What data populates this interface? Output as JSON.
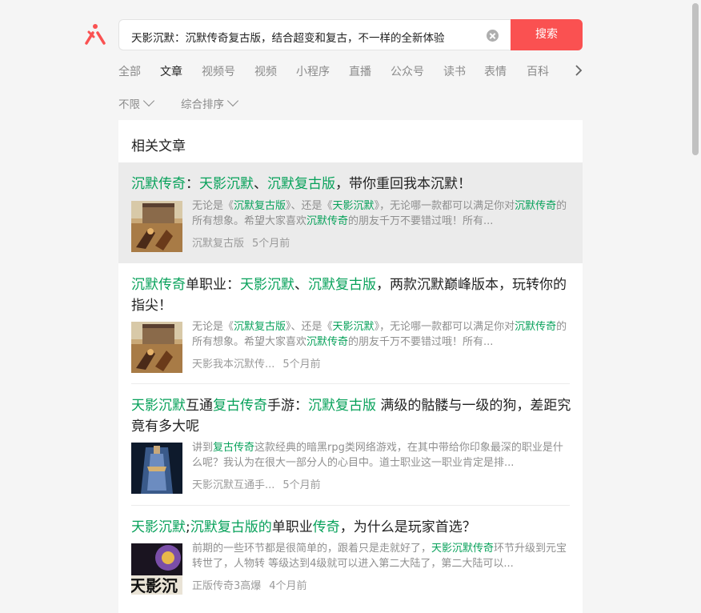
{
  "search": {
    "query": "天影沉默：沉默传奇复古版，结合超变和复古，不一样的全新体验",
    "button": "搜索"
  },
  "tabs": [
    "全部",
    "文章",
    "视频号",
    "视频",
    "小程序",
    "直播",
    "公众号",
    "读书",
    "表情",
    "百科"
  ],
  "filters": [
    "不限",
    "综合排序"
  ],
  "section_title": "相关文章",
  "articles": [
    {
      "title": [
        [
          "g",
          "沉默传奇"
        ],
        [
          "n",
          "："
        ],
        [
          "g",
          "天影沉默"
        ],
        [
          "n",
          "、"
        ],
        [
          "g",
          "沉默复古版"
        ],
        [
          "n",
          "，带你重回我本沉默！"
        ]
      ],
      "desc": [
        [
          "n",
          "无论是《"
        ],
        [
          "g",
          "沉默复古版"
        ],
        [
          "n",
          "》、还是《"
        ],
        [
          "g",
          "天影沉默"
        ],
        [
          "n",
          "》，无论哪一款都可以满足你对"
        ],
        [
          "g",
          "沉默传奇"
        ],
        [
          "n",
          "的所有想象。希望大家喜欢"
        ],
        [
          "g",
          "沉默传奇"
        ],
        [
          "n",
          "的朋友千万不要错过哦！所有..."
        ]
      ],
      "source": "沉默复古版",
      "time": "5个月前"
    },
    {
      "title": [
        [
          "g",
          "沉默传奇"
        ],
        [
          "n",
          "单职业："
        ],
        [
          "g",
          "天影沉默"
        ],
        [
          "n",
          "、"
        ],
        [
          "g",
          "沉默复古版"
        ],
        [
          "n",
          "，两款沉默巅峰版本，玩转你的指尖！"
        ]
      ],
      "desc": [
        [
          "n",
          "无论是《"
        ],
        [
          "g",
          "沉默复古版"
        ],
        [
          "n",
          "》、还是《"
        ],
        [
          "g",
          "天影沉默"
        ],
        [
          "n",
          "》，无论哪一款都可以满足你对"
        ],
        [
          "g",
          "沉默传奇"
        ],
        [
          "n",
          "的所有想象。希望大家喜欢"
        ],
        [
          "g",
          "沉默传奇"
        ],
        [
          "n",
          "的朋友千万不要错过哦！所有..."
        ]
      ],
      "source": "天影我本沉默传...",
      "time": "5个月前"
    },
    {
      "title": [
        [
          "g",
          "天影沉默"
        ],
        [
          "n",
          "互通"
        ],
        [
          "g",
          "复古传奇"
        ],
        [
          "n",
          "手游："
        ],
        [
          "g",
          "沉默复古版"
        ],
        [
          "n",
          " 满级的骷髅与一级的狗，差距究竟有多大呢"
        ]
      ],
      "desc": [
        [
          "n",
          "讲到"
        ],
        [
          "g",
          "复古传奇"
        ],
        [
          "n",
          "这款经典的暗黑rpg类网络游戏，在其中带给你印象最深的职业是什么呢？我认为在很大一部分人的心目中。道士职业这一职业肯定是排..."
        ]
      ],
      "source": "天影沉默互通手...",
      "time": "5个月前"
    },
    {
      "title": [
        [
          "g",
          "天影沉默"
        ],
        [
          "n",
          ";"
        ],
        [
          "g",
          "沉默复古版的"
        ],
        [
          "n",
          "单职业"
        ],
        [
          "g",
          "传奇"
        ],
        [
          "n",
          "，为什么是玩家首选？"
        ]
      ],
      "desc": [
        [
          "n",
          "前期的一些环节都是很简单的，跟着只是走就好了，"
        ],
        [
          "g",
          "天影沉默传奇"
        ],
        [
          "n",
          "环节升级到元宝转世了，人物转 等级达到4级就可以进入第二大陆了，第二大陆可以..."
        ]
      ],
      "source": "正版传奇3高爆",
      "time": "4个月前",
      "thumb_text": "天影沉"
    }
  ],
  "colors": {
    "accent": "#fa5151",
    "highlight": "#07a15a"
  }
}
